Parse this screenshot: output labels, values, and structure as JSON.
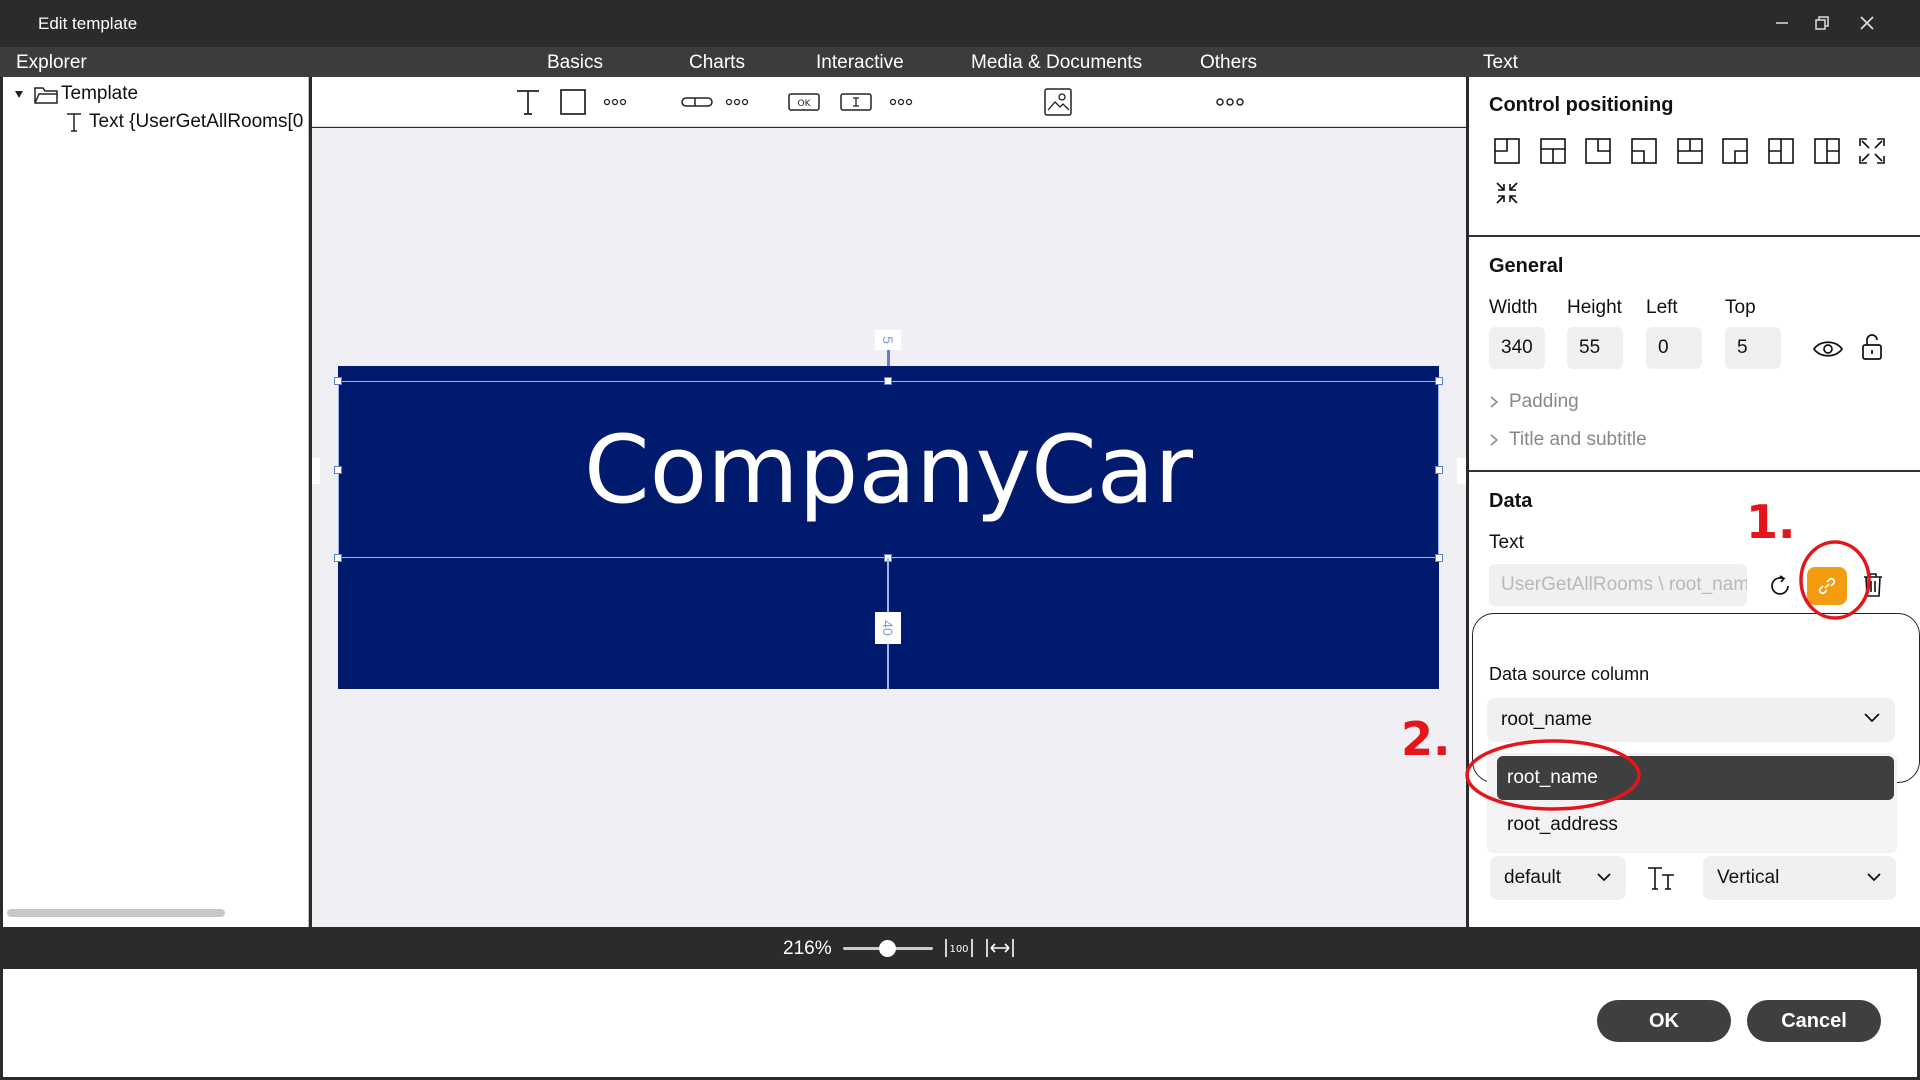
{
  "window": {
    "title": "Edit template"
  },
  "header": {
    "explorer_title": "Explorer",
    "properties_title": "Text",
    "tabs": [
      {
        "label": "Basics"
      },
      {
        "label": "Charts"
      },
      {
        "label": "Interactive"
      },
      {
        "label": "Media & Documents"
      },
      {
        "label": "Others"
      }
    ]
  },
  "explorer": {
    "root": "Template",
    "child": "Text {UserGetAllRooms[0"
  },
  "canvas": {
    "banner_text": "CompanyCar",
    "banner_color": "#001a6e",
    "measure_top": "5",
    "measure_bottom": "40"
  },
  "properties": {
    "control_positioning_title": "Control positioning",
    "general_title": "General",
    "width_label": "Width",
    "height_label": "Height",
    "left_label": "Left",
    "top_label": "Top",
    "width_value": "340",
    "height_value": "55",
    "left_value": "0",
    "top_value": "5",
    "padding_label": "Padding",
    "title_subtitle_label": "Title and subtitle",
    "data_title": "Data",
    "text_label": "Text",
    "text_value": "UserGetAllRooms \\ root_name",
    "link_button_color": "#f39c12"
  },
  "popup": {
    "label": "Data source column",
    "selected": "root_name",
    "options": [
      "root_name",
      "root_address"
    ]
  },
  "bottom_controls": {
    "font_size": "default",
    "orientation": "Vertical"
  },
  "annotations": {
    "step1": "1.",
    "step2": "2.",
    "color": "#e3161c"
  },
  "statusbar": {
    "zoom": "216%"
  },
  "footer": {
    "ok": "OK",
    "cancel": "Cancel"
  }
}
